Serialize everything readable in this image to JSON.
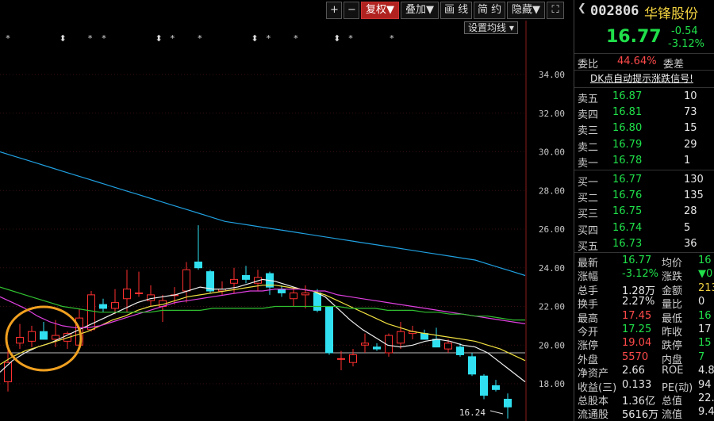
{
  "toolbar": {
    "plus": "+",
    "minus": "−",
    "fuquan": "复权▼",
    "diejia": "叠加▼",
    "huaxian": "画 线",
    "jianyue": "简 约",
    "yincang": "隐藏▼",
    "fullscreen": "⛶"
  },
  "settings_button": "设置均线 ▾",
  "header": {
    "code": "002806",
    "name": "华锋股份",
    "price": "16.77",
    "change": "-0.54",
    "change_pct": "-3.12%"
  },
  "weibi": {
    "label": "委比",
    "value": "44.64%",
    "label2": "委差"
  },
  "signal_link": "DK点自动提示涨跌信号!",
  "asks": [
    {
      "label": "卖五",
      "price": "16.87",
      "vol": "10"
    },
    {
      "label": "卖四",
      "price": "16.81",
      "vol": "73"
    },
    {
      "label": "卖三",
      "price": "16.80",
      "vol": "15"
    },
    {
      "label": "卖二",
      "price": "16.79",
      "vol": "29"
    },
    {
      "label": "卖一",
      "price": "16.78",
      "vol": "1"
    }
  ],
  "bids": [
    {
      "label": "买一",
      "price": "16.77",
      "vol": "130"
    },
    {
      "label": "买二",
      "price": "16.76",
      "vol": "135"
    },
    {
      "label": "买三",
      "price": "16.75",
      "vol": "28"
    },
    {
      "label": "买四",
      "price": "16.74",
      "vol": "5"
    },
    {
      "label": "买五",
      "price": "16.73",
      "vol": "36"
    }
  ],
  "stats": [
    {
      "l1": "最新",
      "v1": "16.77",
      "c1": "green",
      "l2": "均价",
      "v2": "16",
      "c2": "green"
    },
    {
      "l1": "涨幅",
      "v1": "-3.12%",
      "c1": "green",
      "l2": "涨跌",
      "v2": "▼0",
      "c2": "green"
    },
    {
      "l1": "总手",
      "v1": "1.28万",
      "c1": "white",
      "l2": "金额",
      "v2": "213",
      "c2": "yellow"
    },
    {
      "l1": "换手",
      "v1": "2.27%",
      "c1": "white",
      "l2": "量比",
      "v2": "0",
      "c2": "white"
    },
    {
      "l1": "最高",
      "v1": "17.45",
      "c1": "red",
      "l2": "最低",
      "v2": "16",
      "c2": "green"
    },
    {
      "l1": "今开",
      "v1": "17.25",
      "c1": "green",
      "l2": "昨收",
      "v2": "17",
      "c2": "white"
    },
    {
      "l1": "涨停",
      "v1": "19.04",
      "c1": "red",
      "l2": "跌停",
      "v2": "15",
      "c2": "green"
    },
    {
      "l1": "外盘",
      "v1": "5570",
      "c1": "red",
      "l2": "内盘",
      "v2": "7",
      "c2": "green"
    },
    {
      "l1": "净资产",
      "v1": "2.66",
      "c1": "white",
      "l2": "ROE",
      "v2": "4.8",
      "c2": "white"
    },
    {
      "l1": "收益(三)",
      "v1": "0.133",
      "c1": "white",
      "l2": "PE(动)",
      "v2": "94",
      "c2": "white"
    },
    {
      "l1": "总股本",
      "v1": "1.36亿",
      "c1": "white",
      "l2": "总值",
      "v2": "22.",
      "c2": "white"
    },
    {
      "l1": "流通股",
      "v1": "5616万",
      "c1": "white",
      "l2": "流值",
      "v2": "9.4",
      "c2": "white"
    }
  ],
  "chart_data": {
    "type": "candlestick",
    "y_ticks": [
      "34.00",
      "32.00",
      "30.00",
      "28.00",
      "26.00",
      "24.00",
      "22.00",
      "20.00",
      "18.00"
    ],
    "ylim": [
      16.0,
      35.0
    ],
    "low_label": "16.24",
    "reference_price": 19.6,
    "candles": [
      {
        "o": 18.1,
        "h": 19.8,
        "l": 17.6,
        "c": 19.1
      },
      {
        "o": 20.1,
        "h": 21.1,
        "l": 19.8,
        "c": 20.4
      },
      {
        "o": 20.2,
        "h": 21.0,
        "l": 19.9,
        "c": 20.7
      },
      {
        "o": 20.7,
        "h": 21.2,
        "l": 20.3,
        "c": 20.3
      },
      {
        "o": 20.3,
        "h": 21.3,
        "l": 19.9,
        "c": 20.5
      },
      {
        "o": 20.2,
        "h": 20.7,
        "l": 19.8,
        "c": 20.6
      },
      {
        "o": 20.0,
        "h": 21.9,
        "l": 19.9,
        "c": 21.4
      },
      {
        "o": 20.8,
        "h": 22.8,
        "l": 20.7,
        "c": 22.6
      },
      {
        "o": 22.1,
        "h": 22.4,
        "l": 21.7,
        "c": 21.9
      },
      {
        "o": 21.9,
        "h": 22.9,
        "l": 21.6,
        "c": 22.2
      },
      {
        "o": 22.4,
        "h": 23.9,
        "l": 21.7,
        "c": 22.9
      },
      {
        "o": 22.7,
        "h": 23.8,
        "l": 22.5,
        "c": 22.7
      },
      {
        "o": 22.3,
        "h": 23.1,
        "l": 22.0,
        "c": 22.6
      },
      {
        "o": 22.0,
        "h": 22.6,
        "l": 21.2,
        "c": 22.3
      },
      {
        "o": 22.6,
        "h": 23.0,
        "l": 22.1,
        "c": 22.6
      },
      {
        "o": 22.8,
        "h": 24.3,
        "l": 22.2,
        "c": 23.9
      },
      {
        "o": 24.3,
        "h": 26.2,
        "l": 23.9,
        "c": 24.0
      },
      {
        "o": 23.8,
        "h": 23.9,
        "l": 22.7,
        "c": 22.8
      },
      {
        "o": 22.8,
        "h": 23.3,
        "l": 22.6,
        "c": 22.9
      },
      {
        "o": 23.2,
        "h": 24.0,
        "l": 22.7,
        "c": 23.4
      },
      {
        "o": 23.6,
        "h": 24.1,
        "l": 23.2,
        "c": 23.4
      },
      {
        "o": 23.2,
        "h": 23.9,
        "l": 22.8,
        "c": 23.5
      },
      {
        "o": 23.7,
        "h": 23.8,
        "l": 22.6,
        "c": 23.0
      },
      {
        "o": 22.9,
        "h": 23.1,
        "l": 22.5,
        "c": 22.7
      },
      {
        "o": 22.4,
        "h": 22.9,
        "l": 22.0,
        "c": 22.7
      },
      {
        "o": 22.6,
        "h": 23.1,
        "l": 21.9,
        "c": 22.7
      },
      {
        "o": 22.7,
        "h": 22.9,
        "l": 21.7,
        "c": 21.8
      },
      {
        "o": 22.0,
        "h": 22.0,
        "l": 19.5,
        "c": 19.6
      },
      {
        "o": 19.3,
        "h": 19.7,
        "l": 18.7,
        "c": 19.3
      },
      {
        "o": 19.1,
        "h": 19.8,
        "l": 18.9,
        "c": 19.5
      },
      {
        "o": 20.0,
        "h": 20.6,
        "l": 19.6,
        "c": 20.1
      },
      {
        "o": 19.9,
        "h": 20.1,
        "l": 19.7,
        "c": 19.8
      },
      {
        "o": 19.6,
        "h": 20.6,
        "l": 19.4,
        "c": 20.5
      },
      {
        "o": 20.1,
        "h": 21.2,
        "l": 19.8,
        "c": 20.7
      },
      {
        "o": 20.6,
        "h": 21.0,
        "l": 20.3,
        "c": 20.7
      },
      {
        "o": 20.6,
        "h": 20.8,
        "l": 20.3,
        "c": 20.3
      },
      {
        "o": 20.3,
        "h": 20.9,
        "l": 19.9,
        "c": 19.9
      },
      {
        "o": 19.8,
        "h": 20.3,
        "l": 19.6,
        "c": 20.1
      },
      {
        "o": 19.9,
        "h": 20.1,
        "l": 19.4,
        "c": 19.5
      },
      {
        "o": 19.4,
        "h": 19.6,
        "l": 18.4,
        "c": 18.5
      },
      {
        "o": 18.4,
        "h": 18.5,
        "l": 17.2,
        "c": 17.4
      },
      {
        "o": 17.9,
        "h": 18.2,
        "l": 17.6,
        "c": 17.7
      },
      {
        "o": 17.2,
        "h": 17.5,
        "l": 16.2,
        "c": 16.8
      }
    ],
    "ma": [
      {
        "color": "#f0f0f0",
        "values": [
          18.6,
          19.2,
          19.6,
          19.9,
          20.1,
          20.4,
          20.7,
          21.0,
          21.3,
          21.6,
          21.9,
          22.2,
          22.4,
          22.5,
          22.6,
          22.8,
          23.0,
          22.9,
          22.9,
          23.0,
          23.2,
          23.4,
          23.3,
          23.1,
          22.9,
          22.8,
          22.5,
          21.9,
          21.3,
          20.8,
          20.4,
          20.0,
          19.9,
          20.0,
          20.2,
          20.3,
          20.2,
          20.0,
          19.9,
          19.6,
          19.1,
          18.6,
          18.1
        ]
      },
      {
        "color": "#f0e040",
        "values": [
          19.0,
          19.4,
          19.7,
          19.9,
          20.1,
          20.3,
          20.5,
          20.7,
          21.0,
          21.3,
          21.5,
          21.8,
          22.0,
          22.1,
          22.3,
          22.5,
          22.6,
          22.7,
          22.8,
          22.9,
          23.0,
          23.1,
          23.1,
          23.0,
          22.9,
          22.8,
          22.6,
          22.3,
          22.0,
          21.7,
          21.4,
          21.1,
          20.9,
          20.7,
          20.6,
          20.5,
          20.4,
          20.3,
          20.2,
          20.0,
          19.8,
          19.5,
          19.2
        ]
      },
      {
        "color": "#e040e0",
        "values": [
          22.5,
          22.2,
          21.9,
          21.5,
          21.2,
          21.0,
          20.9,
          20.9,
          21.0,
          21.2,
          21.4,
          21.6,
          21.8,
          22.0,
          22.2,
          22.3,
          22.4,
          22.5,
          22.6,
          22.7,
          22.8,
          22.8,
          22.9,
          22.9,
          22.9,
          22.8,
          22.8,
          22.6,
          22.5,
          22.4,
          22.3,
          22.2,
          22.1,
          22.0,
          21.9,
          21.8,
          21.7,
          21.6,
          21.5,
          21.4,
          21.3,
          21.2,
          21.1
        ]
      },
      {
        "color": "#30c030",
        "values": [
          23.0,
          22.8,
          22.6,
          22.4,
          22.2,
          22.0,
          21.9,
          21.8,
          21.7,
          21.7,
          21.7,
          21.7,
          21.7,
          21.8,
          21.8,
          21.8,
          21.8,
          21.9,
          21.9,
          21.9,
          21.9,
          21.9,
          22.0,
          22.0,
          22.0,
          22.0,
          22.0,
          22.0,
          21.9,
          21.9,
          21.9,
          21.8,
          21.8,
          21.8,
          21.7,
          21.7,
          21.6,
          21.6,
          21.5,
          21.5,
          21.4,
          21.3,
          21.3
        ]
      },
      {
        "color": "#20a0e0",
        "values": [
          30.0,
          29.8,
          29.6,
          29.4,
          29.2,
          29.0,
          28.8,
          28.6,
          28.4,
          28.2,
          28.0,
          27.8,
          27.6,
          27.4,
          27.2,
          27.0,
          26.8,
          26.6,
          26.4,
          26.3,
          26.2,
          26.1,
          26.0,
          25.9,
          25.8,
          25.7,
          25.6,
          25.5,
          25.4,
          25.3,
          25.2,
          25.1,
          25.0,
          24.9,
          24.8,
          24.7,
          24.6,
          24.5,
          24.4,
          24.2,
          24.0,
          23.8,
          23.6
        ]
      }
    ]
  }
}
